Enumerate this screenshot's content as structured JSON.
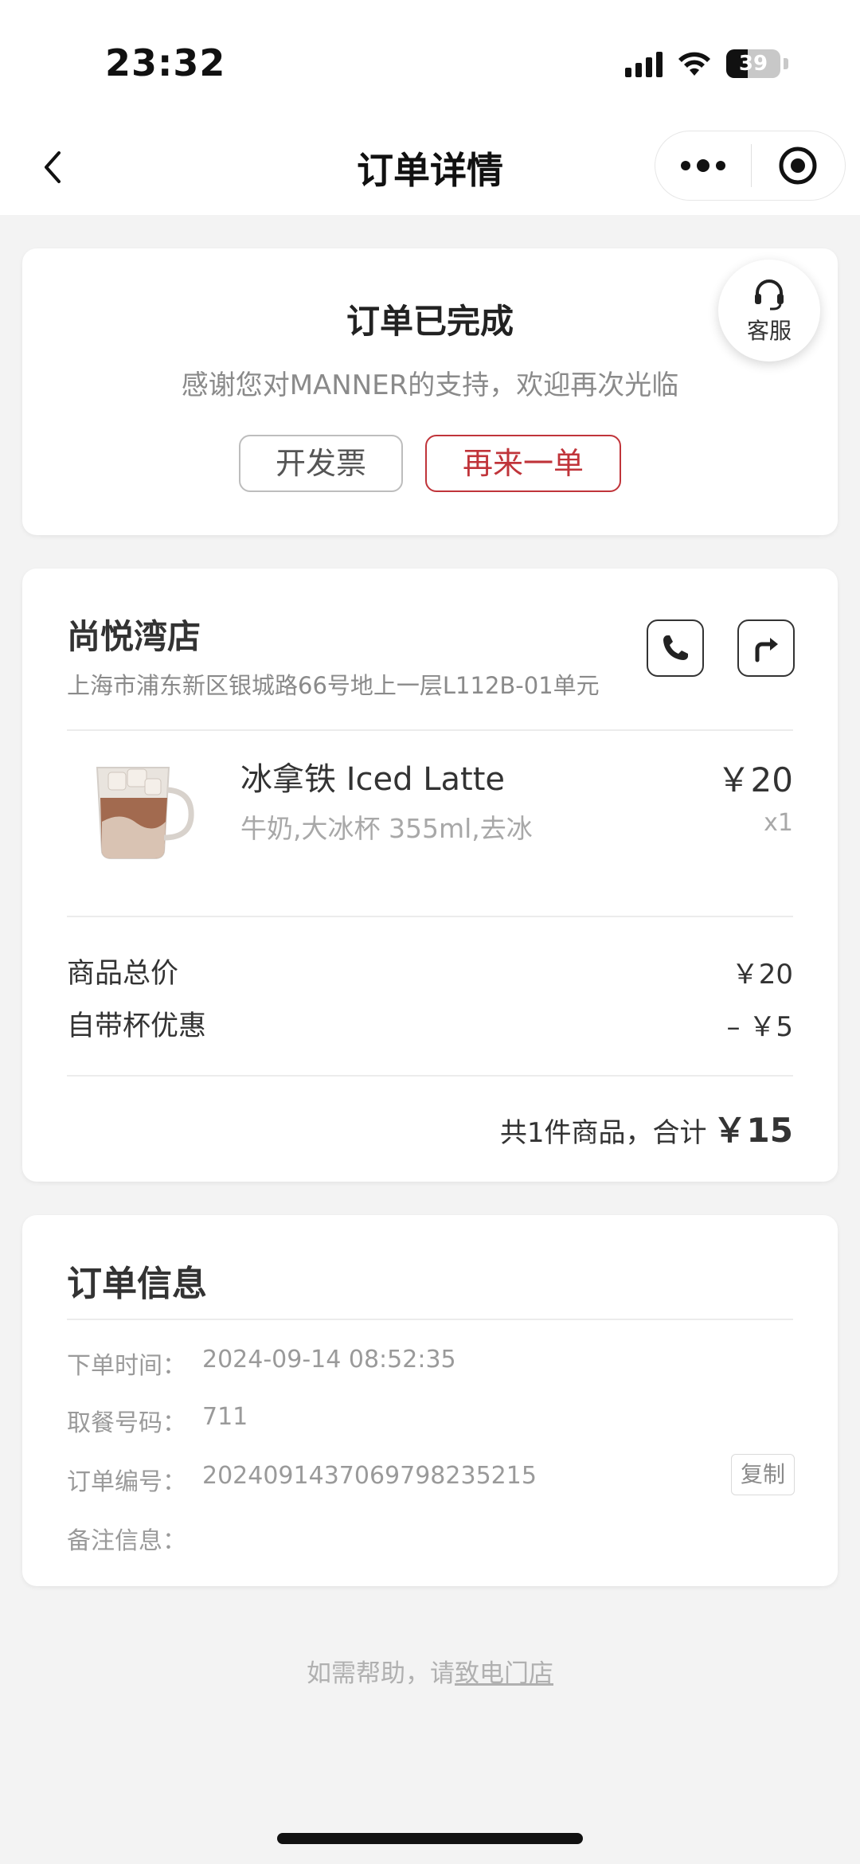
{
  "status_bar": {
    "time": "23:32",
    "battery": "39"
  },
  "nav": {
    "title": "订单详情"
  },
  "order_status": {
    "title": "订单已完成",
    "message": "感谢您对MANNER的支持，欢迎再次光临",
    "invoice_label": "开发票",
    "reorder_label": "再来一单",
    "service_label": "客服"
  },
  "store": {
    "name": "尚悦湾店",
    "address": "上海市浦东新区银城路66号地上一层L112B-01单元"
  },
  "product": {
    "name": "冰拿铁 Iced Latte",
    "spec": "牛奶,大冰杯 355ml,去冰",
    "price": "￥20",
    "qty": "x1"
  },
  "summary": {
    "subtotal_label": "商品总价",
    "subtotal_value": "￥20",
    "discount_label": "自带杯优惠",
    "discount_value": "– ￥5",
    "total_prefix": "共1件商品，合计",
    "total_value": "￥15"
  },
  "order_info": {
    "title": "订单信息",
    "time_label": "下单时间：",
    "time_value": "2024-09-14 08:52:35",
    "pickup_label": "取餐号码：",
    "pickup_value": "711",
    "number_label": "订单编号：",
    "number_value": "20240914370697982352​15",
    "copy_label": "复制",
    "remark_label": "备注信息："
  },
  "help": {
    "prefix": "如需帮助，请",
    "link": "致电门店"
  },
  "colors": {
    "accent": "#c0343a",
    "background": "#f3f3f3"
  }
}
